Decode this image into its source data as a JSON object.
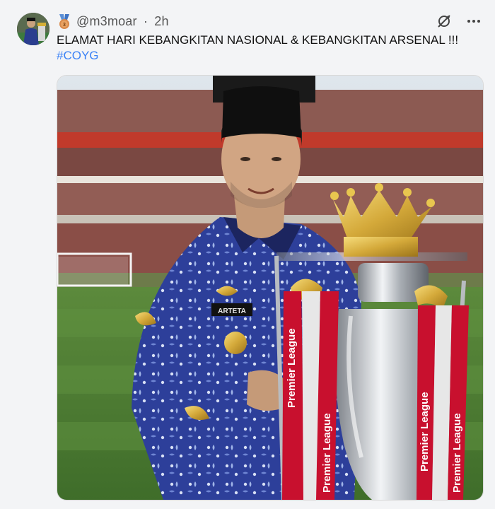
{
  "post": {
    "handle": "@m3moar",
    "separator": "·",
    "time": "2h",
    "text": "ELAMAT HARI KEBANGKITAN NASIONAL & KEBANGKITAN ARSENAL !!!",
    "hashtag": "#COYG"
  },
  "image": {
    "name_tag": "ARTETA",
    "ribbon_text": "Premier League"
  },
  "icons": {
    "badge": "medal-icon",
    "slash": "hide-icon",
    "more": "more-icon"
  },
  "colors": {
    "background": "#f3f4f6",
    "hashtag": "#3b82f6",
    "ribbon": "#c8102e"
  }
}
